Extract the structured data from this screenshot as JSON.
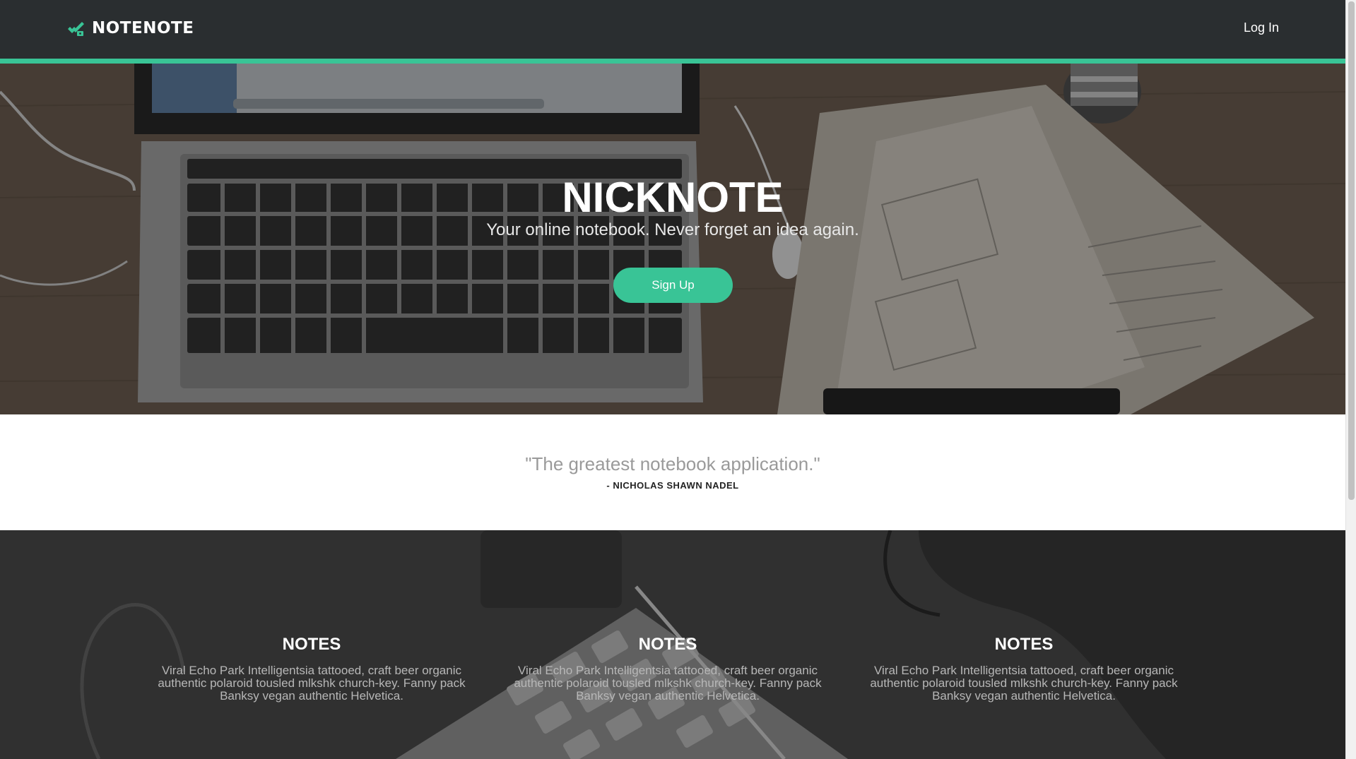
{
  "navbar": {
    "brand": "NOTENOTE",
    "login_label": "Log In"
  },
  "hero": {
    "title": "NICKNOTE",
    "subtitle": "Your online notebook. Never forget an idea again.",
    "signup_label": "Sign Up"
  },
  "quote": {
    "text": "\"The greatest notebook application.\"",
    "author": "- NICHOLAS SHAWN NADEL"
  },
  "features": [
    {
      "title": "NOTES",
      "text": "Viral Echo Park Intelligentsia tattooed, craft beer organic authentic polaroid tousled mlkshk church-key. Fanny pack Banksy vegan authentic Helvetica."
    },
    {
      "title": "NOTES",
      "text": "Viral Echo Park Intelligentsia tattooed, craft beer organic authentic polaroid tousled mlkshk church-key. Fanny pack Banksy vegan authentic Helvetica."
    },
    {
      "title": "NOTES",
      "text": "Viral Echo Park Intelligentsia tattooed, craft beer organic authentic polaroid tousled mlkshk church-key. Fanny pack Banksy vegan authentic Helvetica."
    }
  ],
  "colors": {
    "accent": "#39c496",
    "navbar_bg": "#2a2e30"
  },
  "icons": {
    "brand": "pencil-checkmark-icon"
  }
}
